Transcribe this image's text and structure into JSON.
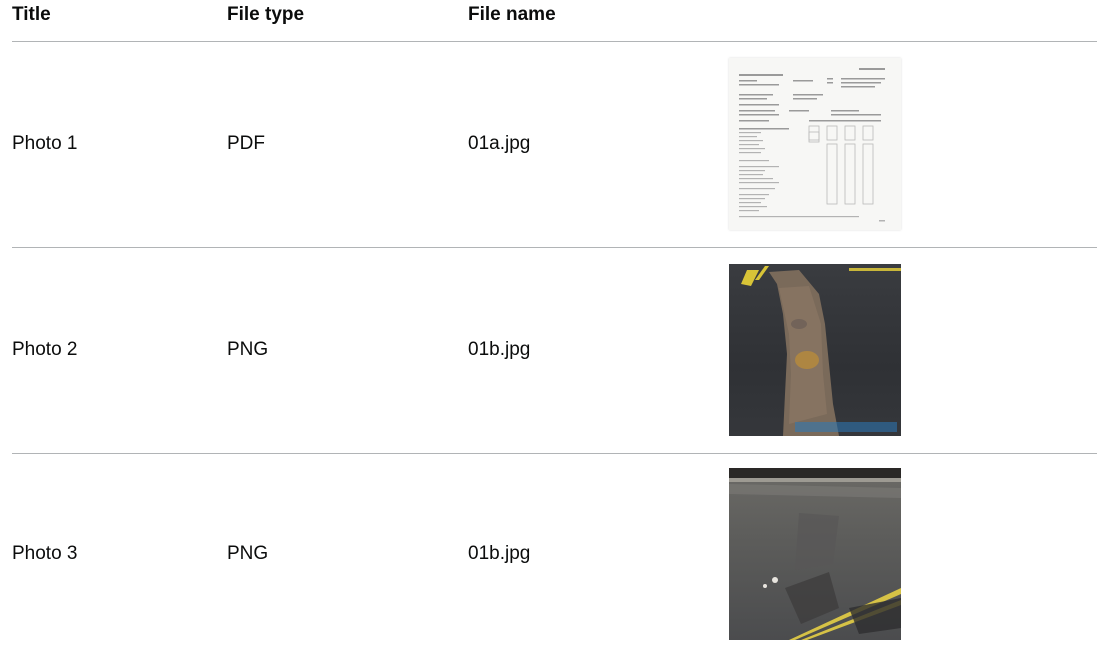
{
  "table": {
    "headers": {
      "title": "Title",
      "file_type": "File type",
      "file_name": "File name"
    },
    "rows": [
      {
        "title": "Photo 1",
        "file_type": "PDF",
        "file_name": "01a.jpg",
        "thumbnail": "form-document-thumbnail"
      },
      {
        "title": "Photo 2",
        "file_type": "PNG",
        "file_name": "01b.jpg",
        "thumbnail": "road-patch-thumbnail"
      },
      {
        "title": "Photo 3",
        "file_type": "PNG",
        "file_name": "01b.jpg",
        "thumbnail": "road-yellow-lines-thumbnail"
      }
    ]
  },
  "colors": {
    "text": "#0b0c0c",
    "border": "#b1b4b6",
    "background": "#ffffff"
  }
}
